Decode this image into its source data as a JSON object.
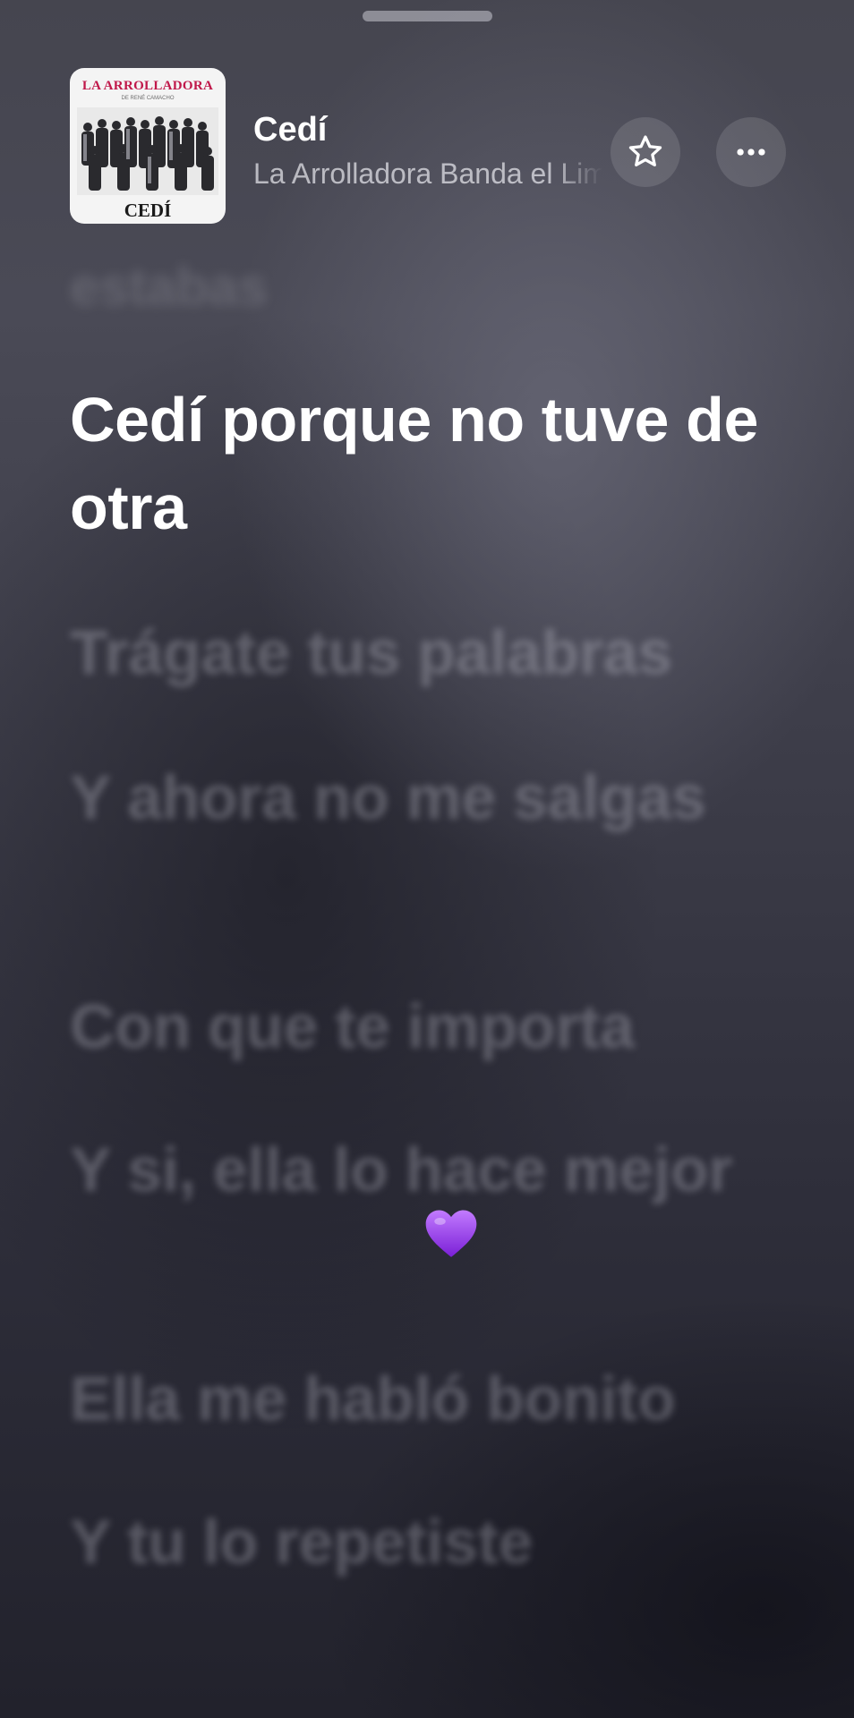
{
  "track": {
    "title": "Cedí",
    "artist": "La Arrolladora Banda el Limón de René Camacho"
  },
  "cover": {
    "brand": "LA ARROLLADORA",
    "subtitle": "DE RENÉ CAMACHO",
    "title": "CEDÍ"
  },
  "actions": {
    "favorite_icon": "star-icon",
    "more_icon": "ellipsis-icon"
  },
  "lyrics": {
    "previous": "estabas",
    "current": "Cedí porque no tuve de otra",
    "upcoming": [
      "Trágate tus palabras",
      "Y ahora no me salgas",
      "Con que te importa",
      "Y si, ella lo hace mejor",
      "Ella me habló bonito",
      "Y tu lo repetiste"
    ]
  },
  "overlay": {
    "emoji": "purple-heart-icon",
    "color": "#9b3cf0"
  }
}
